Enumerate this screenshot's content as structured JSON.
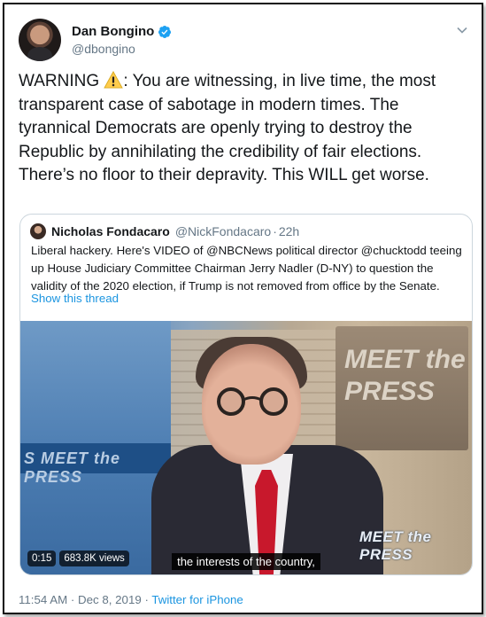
{
  "author": {
    "name": "Dan Bongino",
    "handle": "@dbongino",
    "verified": true,
    "avatar_icon": "avatar"
  },
  "tweet": {
    "text_before_icon": "WARNING ",
    "warning_icon": "warning-icon",
    "text_after_icon": ": You are witnessing, in live time, the most transparent case of sabotage in modern times. The tyrannical Democrats are openly trying to destroy the Republic by annihilating the credibility of fair elections. There’s no floor to their depravity. This WILL get worse."
  },
  "quoted": {
    "name": "Nicholas Fondacaro",
    "handle": "@NickFondacaro",
    "separator": "·",
    "age": "22h",
    "text": "Liberal hackery. Here's VIDEO of @NBCNews political director @chucktodd teeing up House Judiciary Committee Chairman Jerry Nadler (D-NY) to question the validity of the 2020 election, if Trump is not removed from office by the Senate.",
    "show_thread": "Show this thread",
    "video": {
      "time": "0:15",
      "views": "683.8K views",
      "caption": "the interests of the country,",
      "logo_small": "MEET the PRESS",
      "set_sign": "MEET the PRESS",
      "stripe_text": "S  MEET the PRESS"
    }
  },
  "footer": {
    "time": "11:54 AM",
    "separator": " · ",
    "date": "Dec 8, 2019",
    "source": "Twitter for iPhone"
  },
  "colors": {
    "link": "#1b95e0",
    "muted": "#657786",
    "text": "#14171a",
    "verified": "#1da1f2"
  }
}
